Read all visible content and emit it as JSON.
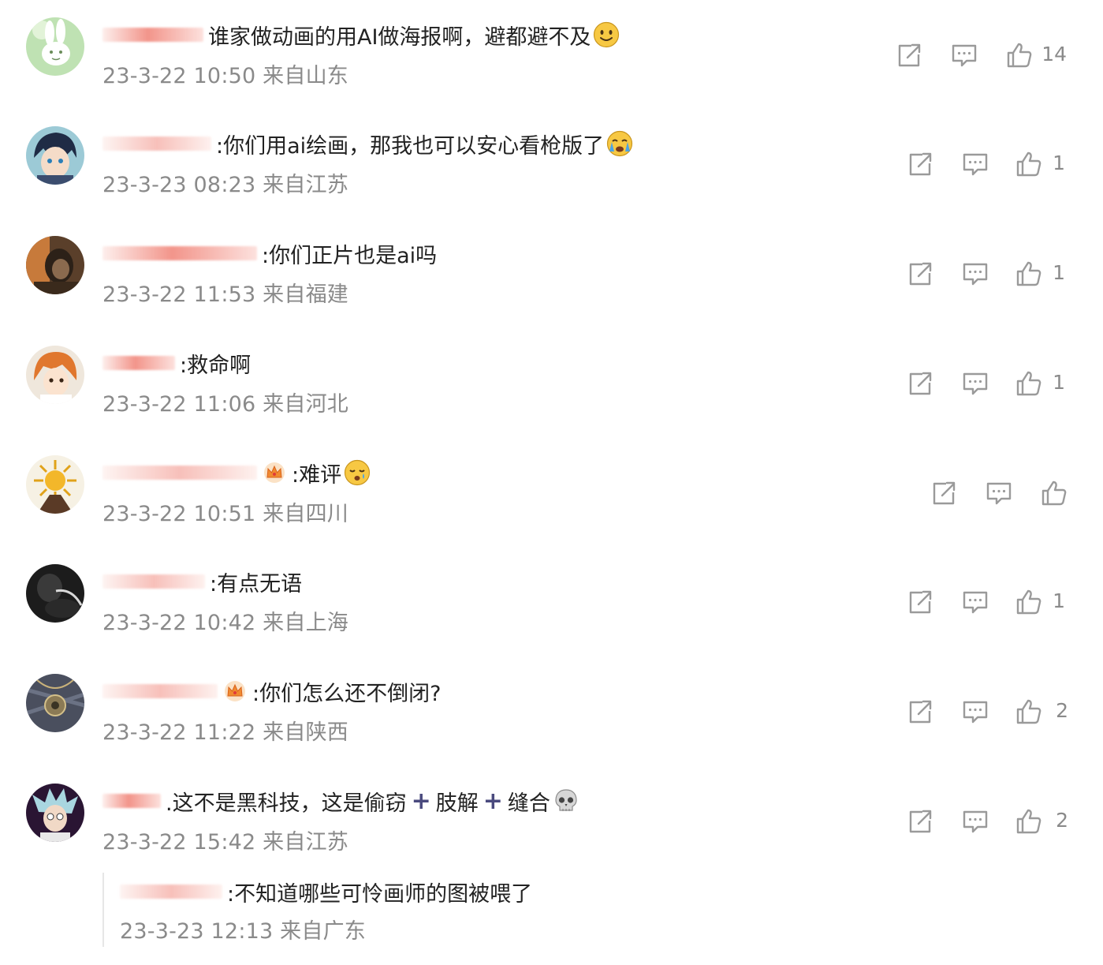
{
  "comments": [
    {
      "text": "谁家做动画的用AI做海报啊，避都避不及",
      "timestamp": "23-3-22 10:50",
      "location": "来自山东",
      "likes": "14",
      "avatar": "rabbit-avatar",
      "emoji": "smile-emoji"
    },
    {
      "text": ":你们用ai绘画，那我也可以安心看枪版了",
      "timestamp": "23-3-23 08:23",
      "location": "来自江苏",
      "likes": "1",
      "avatar": "anime-boy-avatar",
      "emoji": "crying-emoji"
    },
    {
      "text": ":你们正片也是ai吗",
      "timestamp": "23-3-22 11:53",
      "location": "来自福建",
      "likes": "1",
      "avatar": "dark-portrait-avatar"
    },
    {
      "text": ":救命啊",
      "timestamp": "23-3-22 11:06",
      "location": "来自河北",
      "likes": "1",
      "avatar": "orange-hair-avatar"
    },
    {
      "text": ":难评",
      "timestamp": "23-3-22 10:51",
      "location": "来自四川",
      "likes": "",
      "avatar": "sun-volcano-avatar",
      "emoji": "sleepy-emoji",
      "badge": "crown-icon"
    },
    {
      "text": ":有点无语",
      "timestamp": "23-3-22 10:42",
      "location": "来自上海",
      "likes": "1",
      "avatar": "dark-figure-avatar"
    },
    {
      "text": ":你们怎么还不倒闭?",
      "timestamp": "23-3-22 11:22",
      "location": "来自陕西",
      "likes": "2",
      "avatar": "pendant-avatar",
      "badge": "crown-icon"
    },
    {
      "text_parts": [
        ".这不是黑科技，这是偷窃",
        "肢解",
        "缝合"
      ],
      "timestamp": "23-3-22 15:42",
      "location": "来自江苏",
      "likes": "2",
      "avatar": "rick-avatar",
      "emoji": "skull-emoji"
    }
  ],
  "reply": {
    "text": ":不知道哪些可怜画师的图被喂了",
    "timestamp": "23-3-23 12:13",
    "location": "来自广东"
  },
  "icons": {
    "share": "share-icon",
    "comment": "comment-icon",
    "like": "thumbs-up-icon"
  },
  "colors": {
    "meta_text": "#8a8a8a",
    "icon_stroke": "#9a9a9a",
    "redaction": "#f08c80"
  }
}
